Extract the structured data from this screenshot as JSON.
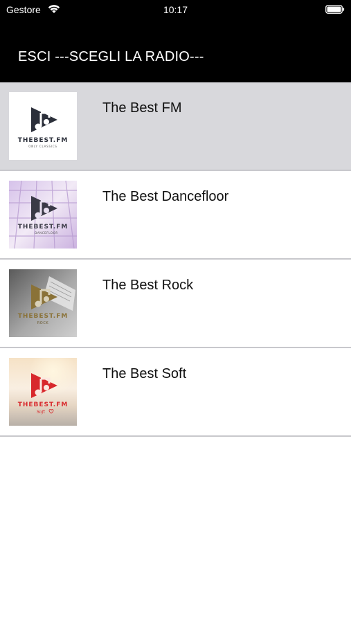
{
  "status_bar": {
    "carrier": "Gestore",
    "time": "10:17",
    "wifi_icon": "wifi-icon",
    "battery_icon": "battery-icon"
  },
  "nav": {
    "title": "ESCI ---SCEGLI LA RADIO---"
  },
  "stations": [
    {
      "name": "The Best FM",
      "logo_text": "THEBEST.FM",
      "logo_sub": "ONLY CLASSICS",
      "selected": true
    },
    {
      "name": "The Best Dancefloor",
      "logo_text": "THEBEST.FM",
      "logo_sub": "DANCEFLOOR",
      "selected": false
    },
    {
      "name": "The Best Rock",
      "logo_text": "THEBEST.FM",
      "logo_sub": "ROCK",
      "selected": false
    },
    {
      "name": "The Best Soft",
      "logo_text": "THEBEST.FM",
      "logo_sub": "Soft",
      "selected": false
    }
  ],
  "colors": {
    "bar_background": "#000000",
    "selected_row": "#d8d8dc",
    "separator": "#c8c8cc",
    "logo_dark": "#2b2f3a",
    "logo_gold": "#8a7238",
    "logo_red": "#d8282c"
  }
}
